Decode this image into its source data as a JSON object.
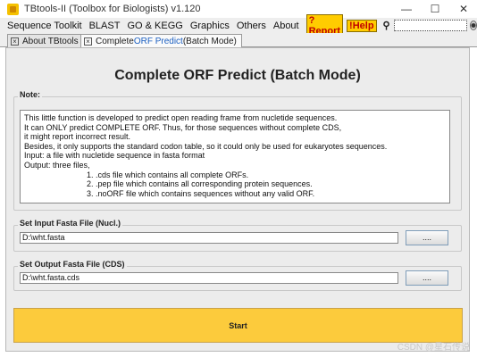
{
  "window": {
    "title": "TBtools-II (Toolbox for Biologists) v1.120",
    "minimize": "—",
    "maximize": "☐",
    "close": "✕"
  },
  "menu": {
    "items": [
      "Sequence Toolkit",
      "BLAST",
      "GO & KEGG",
      "Graphics",
      "Others",
      "About"
    ],
    "report": "?Report",
    "help": "!Help"
  },
  "tabs": [
    {
      "label": "About TBtools"
    },
    {
      "label_prefix": "Complete ",
      "label_highlight": "ORF Predict",
      "label_suffix": " (Batch Mode)"
    }
  ],
  "main": {
    "heading": "Complete ORF Predict (Batch Mode)",
    "note_label": "Note:",
    "note_lines": [
      "This little function is developed to predict open reading frame from nucletide sequences.",
      "It can ONLY predict COMPLETE ORF. Thus, for those sequences without complete CDS,",
      "it might report incorrect result.",
      "Besides, it only supports the standard codon table, so it could only be used for eukaryotes sequences.",
      "Input: a file with nucletide sequence in fasta format",
      "Output: three files,",
      "                            1. .cds file which contains all complete ORFs.",
      "                            2. .pep file which contains all corresponding protein sequences.",
      "                            3. .noORF file which contains sequences without any valid ORF."
    ],
    "input_label": "Set Input Fasta File (Nucl.)",
    "input_value": "D:\\wht.fasta",
    "output_label": "Set Output Fasta File (CDS)",
    "output_value": "D:\\wht.fasta.cds",
    "browse_label": "....",
    "start_label": "Start"
  },
  "watermark": "CSDN @星石传说"
}
